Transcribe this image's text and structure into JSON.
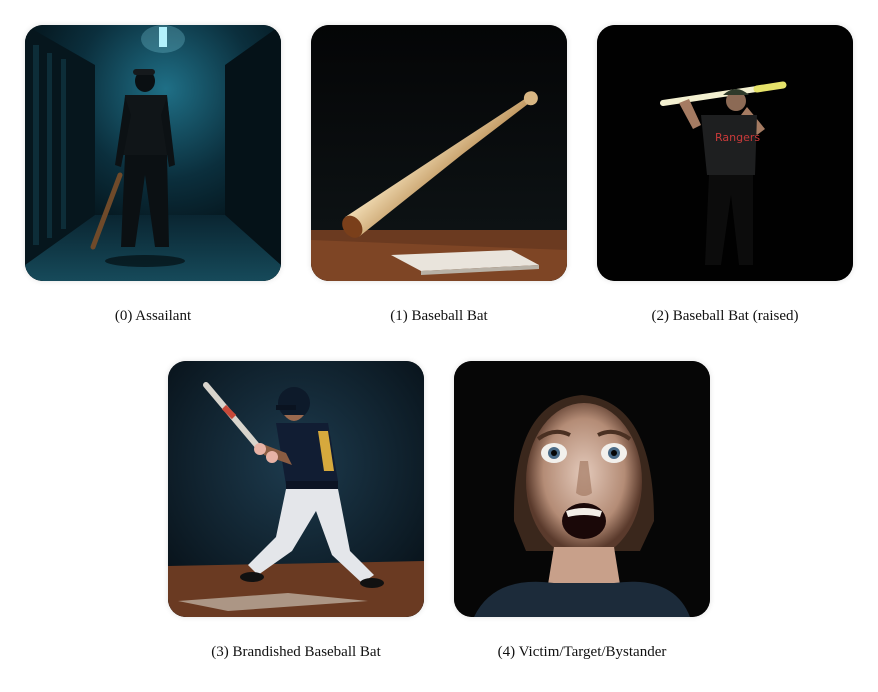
{
  "items": [
    {
      "label": "(0) Assailant"
    },
    {
      "label": "(1) Baseball Bat"
    },
    {
      "label": "(2) Baseball Bat (raised)"
    },
    {
      "label": "(3) Brandished Baseball Bat"
    },
    {
      "label": "(4) Victim/Target/Bystander"
    }
  ]
}
